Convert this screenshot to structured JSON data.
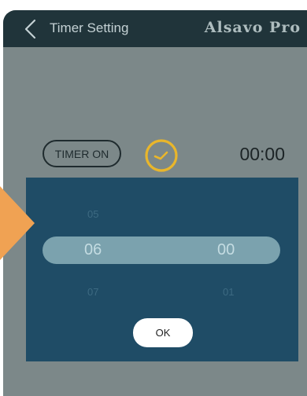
{
  "header": {
    "back_icon": "chevron-left-icon",
    "title": "Timer Setting",
    "brand": "Alsavo Pro"
  },
  "timer": {
    "button_label": "TIMER ON",
    "clock_icon": "clock-icon",
    "value": "00:00"
  },
  "picker": {
    "hours": {
      "prev": "05",
      "selected": "06",
      "next": "07"
    },
    "minutes": {
      "prev": "",
      "selected": "00",
      "next": "01"
    },
    "ok_label": "OK"
  },
  "colors": {
    "header_bg": "#20343a",
    "overlay_bg": "#7c8889",
    "picker_bg": "#1f4c66",
    "selection_bar": "#7ba2ae",
    "clock_accent": "#e9b62b",
    "arrow_accent": "#f0a253"
  }
}
